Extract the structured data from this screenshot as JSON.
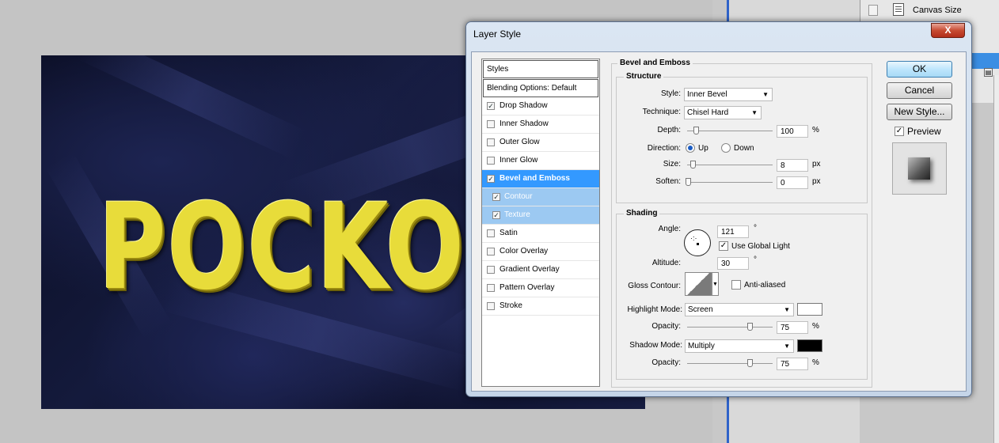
{
  "canvas": {
    "text": "POCKOL"
  },
  "history_panel": {
    "canvas_size_label": "Canvas Size"
  },
  "dialog": {
    "title": "Layer Style",
    "close_label": "X",
    "styles": {
      "header": "Styles",
      "blending": "Blending Options: Default",
      "items": [
        {
          "label": "Drop Shadow",
          "checked": true
        },
        {
          "label": "Inner Shadow",
          "checked": false
        },
        {
          "label": "Outer Glow",
          "checked": false
        },
        {
          "label": "Inner Glow",
          "checked": false
        },
        {
          "label": "Bevel and Emboss",
          "checked": true
        },
        {
          "label": "Contour",
          "checked": true
        },
        {
          "label": "Texture",
          "checked": true
        },
        {
          "label": "Satin",
          "checked": false
        },
        {
          "label": "Color Overlay",
          "checked": false
        },
        {
          "label": "Gradient Overlay",
          "checked": false
        },
        {
          "label": "Pattern Overlay",
          "checked": false
        },
        {
          "label": "Stroke",
          "checked": false
        }
      ]
    },
    "bevel": {
      "section_title": "Bevel and Emboss",
      "structure_title": "Structure",
      "style_label": "Style:",
      "style_value": "Inner Bevel",
      "technique_label": "Technique:",
      "technique_value": "Chisel Hard",
      "depth_label": "Depth:",
      "depth_value": "100",
      "depth_unit": "%",
      "direction_label": "Direction:",
      "direction_up": "Up",
      "direction_down": "Down",
      "size_label": "Size:",
      "size_value": "8",
      "size_unit": "px",
      "soften_label": "Soften:",
      "soften_value": "0",
      "soften_unit": "px"
    },
    "shading": {
      "title": "Shading",
      "angle_label": "Angle:",
      "angle_value": "121",
      "degree": "°",
      "global_light_label": "Use Global Light",
      "altitude_label": "Altitude:",
      "altitude_value": "30",
      "gloss_label": "Gloss Contour:",
      "anti_aliased_label": "Anti-aliased",
      "highlight_label": "Highlight Mode:",
      "highlight_value": "Screen",
      "highlight_color": "#ffffff",
      "opacity_label": "Opacity:",
      "highlight_opacity": "75",
      "shadow_label": "Shadow Mode:",
      "shadow_value": "Multiply",
      "shadow_color": "#000000",
      "shadow_opacity": "75",
      "percent": "%"
    },
    "buttons": {
      "ok": "OK",
      "cancel": "Cancel",
      "new_style": "New Style...",
      "preview": "Preview"
    }
  }
}
